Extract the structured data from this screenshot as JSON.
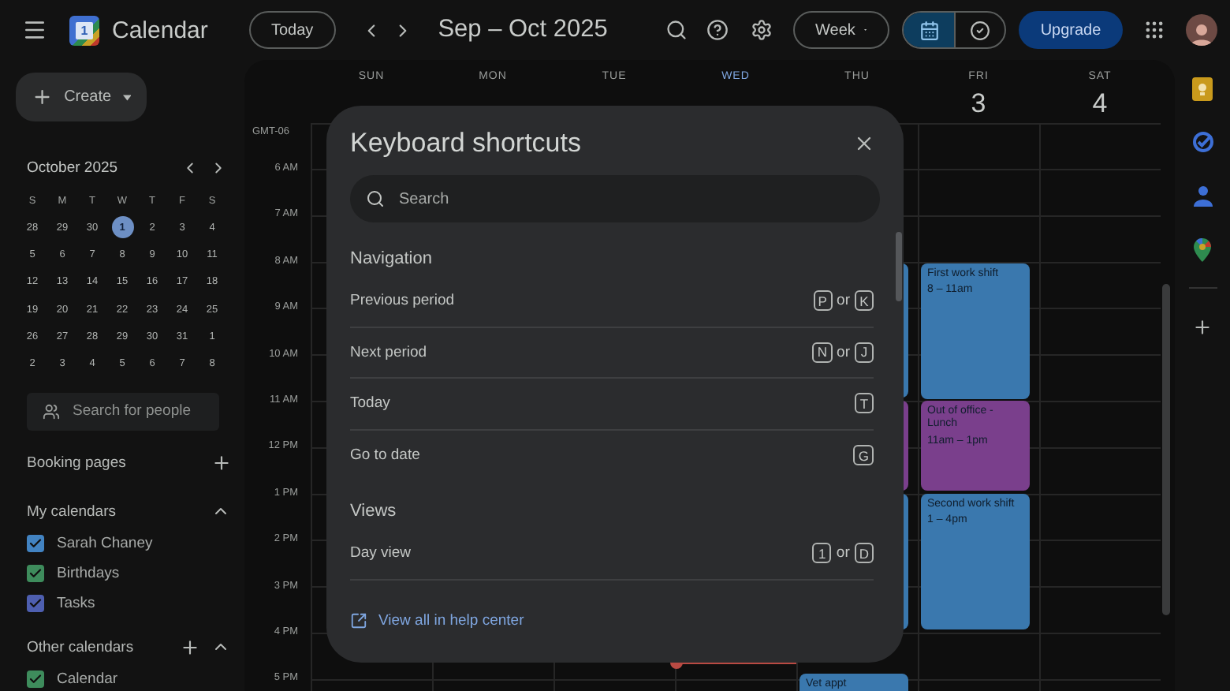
{
  "header": {
    "app_name": "Calendar",
    "logo_day": "1",
    "today_button": "Today",
    "date_range": "Sep – Oct 2025",
    "view_select": "Week",
    "view_toggle": [
      {
        "kind": "calendar",
        "selected": true
      },
      {
        "kind": "tasks",
        "selected": false
      }
    ],
    "upgrade_button": "Upgrade"
  },
  "sidebar": {
    "create_button": "Create",
    "mini_calendar": {
      "title": "October 2025",
      "weekdays": [
        "S",
        "M",
        "T",
        "W",
        "T",
        "F",
        "S"
      ],
      "weeks": [
        [
          {
            "d": "28",
            "today": false
          },
          {
            "d": "29",
            "today": false
          },
          {
            "d": "30",
            "today": false
          },
          {
            "d": "1",
            "today": true
          },
          {
            "d": "2",
            "today": false
          },
          {
            "d": "3",
            "today": false
          },
          {
            "d": "4",
            "today": false
          }
        ],
        [
          {
            "d": "5",
            "today": false
          },
          {
            "d": "6",
            "today": false
          },
          {
            "d": "7",
            "today": false
          },
          {
            "d": "8",
            "today": false
          },
          {
            "d": "9",
            "today": false
          },
          {
            "d": "10",
            "today": false
          },
          {
            "d": "11",
            "today": false
          }
        ],
        [
          {
            "d": "12",
            "today": false
          },
          {
            "d": "13",
            "today": false
          },
          {
            "d": "14",
            "today": false
          },
          {
            "d": "15",
            "today": false
          },
          {
            "d": "16",
            "today": false
          },
          {
            "d": "17",
            "today": false
          },
          {
            "d": "18",
            "today": false
          }
        ],
        [
          {
            "d": "19",
            "today": false
          },
          {
            "d": "20",
            "today": false
          },
          {
            "d": "21",
            "today": false
          },
          {
            "d": "22",
            "today": false
          },
          {
            "d": "23",
            "today": false
          },
          {
            "d": "24",
            "today": false
          },
          {
            "d": "25",
            "today": false
          }
        ],
        [
          {
            "d": "26",
            "today": false
          },
          {
            "d": "27",
            "today": false
          },
          {
            "d": "28",
            "today": false
          },
          {
            "d": "29",
            "today": false
          },
          {
            "d": "30",
            "today": false
          },
          {
            "d": "31",
            "today": false
          },
          {
            "d": "1",
            "today": false
          }
        ],
        [
          {
            "d": "2",
            "today": false
          },
          {
            "d": "3",
            "today": false
          },
          {
            "d": "4",
            "today": false
          },
          {
            "d": "5",
            "today": false
          },
          {
            "d": "6",
            "today": false
          },
          {
            "d": "7",
            "today": false
          },
          {
            "d": "8",
            "today": false
          }
        ]
      ]
    },
    "people_search": {
      "placeholder": "Search for people"
    },
    "booking_pages": "Booking pages",
    "my_calendars": {
      "title": "My calendars",
      "expanded": true,
      "items": [
        {
          "label": "Sarah Chaney",
          "checked": true,
          "color": "#4283c2"
        },
        {
          "label": "Birthdays",
          "checked": true,
          "color": "#3e8c5c"
        },
        {
          "label": "Tasks",
          "checked": true,
          "color": "#4e5fb0"
        }
      ]
    },
    "other_calendars": {
      "title": "Other calendars",
      "expanded": true,
      "items": [
        {
          "label": "Calendar",
          "checked": true,
          "color": "#3e8c5c"
        }
      ]
    }
  },
  "grid": {
    "timezone": "GMT-06",
    "hours": [
      "6 AM",
      "7 AM",
      "8 AM",
      "9 AM",
      "10 AM",
      "11 AM",
      "12 PM",
      "1 PM",
      "2 PM",
      "3 PM",
      "4 PM",
      "5 PM"
    ],
    "days": [
      {
        "name": "SUN",
        "today": false
      },
      {
        "name": "MON",
        "today": false
      },
      {
        "name": "TUE",
        "today": false
      },
      {
        "name": "WED",
        "today": true
      },
      {
        "name": "THU",
        "today": false,
        "events": [
          {
            "color": "#3a78ae"
          },
          {
            "color": "#7a3f8c"
          },
          {
            "color": "#3a78ae"
          },
          {
            "title": "Vet appt",
            "color": "#3a78ae"
          }
        ]
      },
      {
        "name": "FRI",
        "number": "3",
        "today": false,
        "events": [
          {
            "title": "First work shift",
            "time": "8 – 11am",
            "color": "#3a78ae"
          },
          {
            "title": "Out of office - Lunch",
            "time": "11am – 1pm",
            "color": "#7a3f8c"
          },
          {
            "title": "Second work shift",
            "time": "1 – 4pm",
            "color": "#3a78ae"
          }
        ]
      },
      {
        "name": "SAT",
        "number": "4",
        "today": false
      }
    ]
  },
  "dialog": {
    "title": "Keyboard shortcuts",
    "search": {
      "placeholder": "Search"
    },
    "sections": [
      {
        "heading": "Navigation",
        "shortcuts": [
          {
            "label": "Previous period",
            "keys": [
              {
                "kind": "key",
                "text": "P"
              },
              {
                "kind": "word",
                "text": "or"
              },
              {
                "kind": "key",
                "text": "K"
              }
            ]
          },
          {
            "label": "Next period",
            "keys": [
              {
                "kind": "key",
                "text": "N"
              },
              {
                "kind": "word",
                "text": "or"
              },
              {
                "kind": "key",
                "text": "J"
              }
            ]
          },
          {
            "label": "Today",
            "keys": [
              {
                "kind": "key",
                "text": "T"
              }
            ]
          },
          {
            "label": "Go to date",
            "keys": [
              {
                "kind": "key",
                "text": "G"
              }
            ]
          }
        ]
      },
      {
        "heading": "Views",
        "shortcuts": [
          {
            "label": "Day view",
            "keys": [
              {
                "kind": "key",
                "text": "1"
              },
              {
                "kind": "word",
                "text": "or"
              },
              {
                "kind": "key",
                "text": "D"
              }
            ]
          }
        ]
      }
    ],
    "help_link": "View all in help center"
  }
}
